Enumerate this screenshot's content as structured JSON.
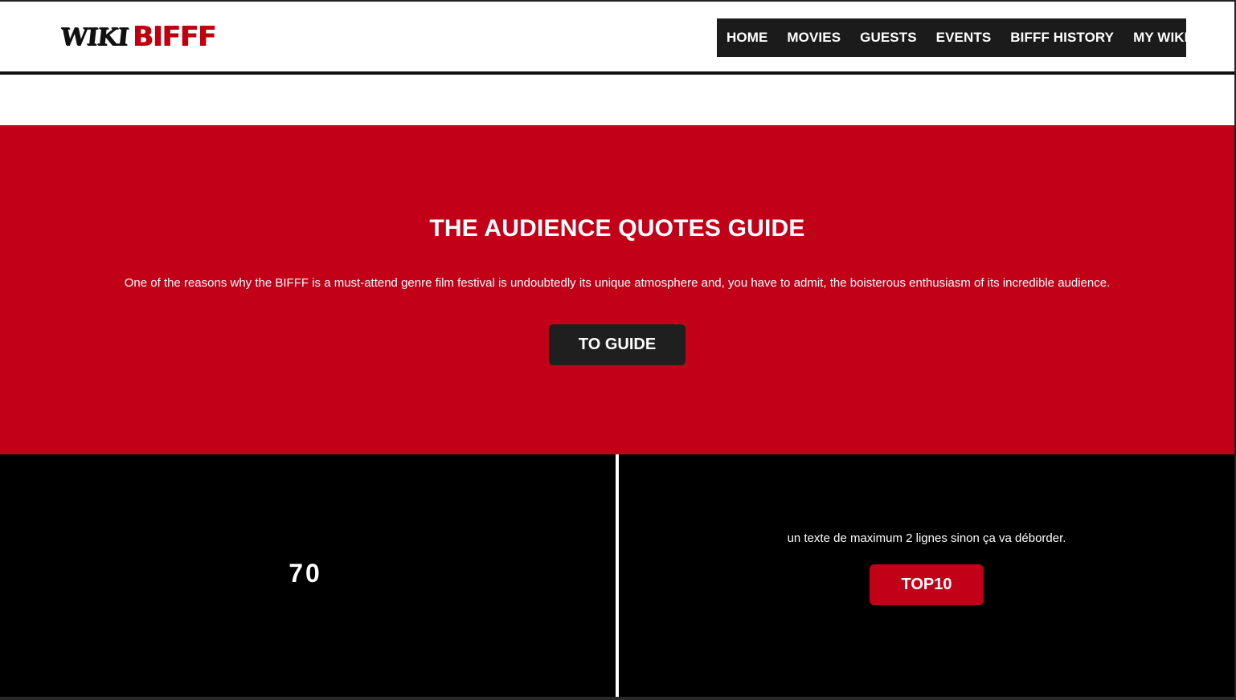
{
  "header": {
    "logo": {
      "wiki": "WIKI",
      "bifff": "BIFFF"
    },
    "nav": [
      {
        "label": "HOME"
      },
      {
        "label": "MOVIES"
      },
      {
        "label": "GUESTS"
      },
      {
        "label": "EVENTS"
      },
      {
        "label": "BIFFF HISTORY"
      },
      {
        "label": "MY WIKI",
        "icon": "caret-down-icon"
      }
    ]
  },
  "hero": {
    "title": "THE AUDIENCE QUOTES GUIDE",
    "text": "One of the reasons why the BIFFF is a must-attend genre film festival is undoubtedly its unique atmosphere and, you have to admit, the boisterous enthusiasm of its incredible audience.",
    "button_label": "TO GUIDE"
  },
  "bottom": {
    "counter": "70",
    "text": "un texte de maximum 2 lignes sinon ça va déborder.",
    "button_label": "TOP10"
  },
  "colors": {
    "brand_red": "#c20017",
    "nav_bg": "#1b1b1b",
    "button_dark": "#1f1f1f"
  }
}
